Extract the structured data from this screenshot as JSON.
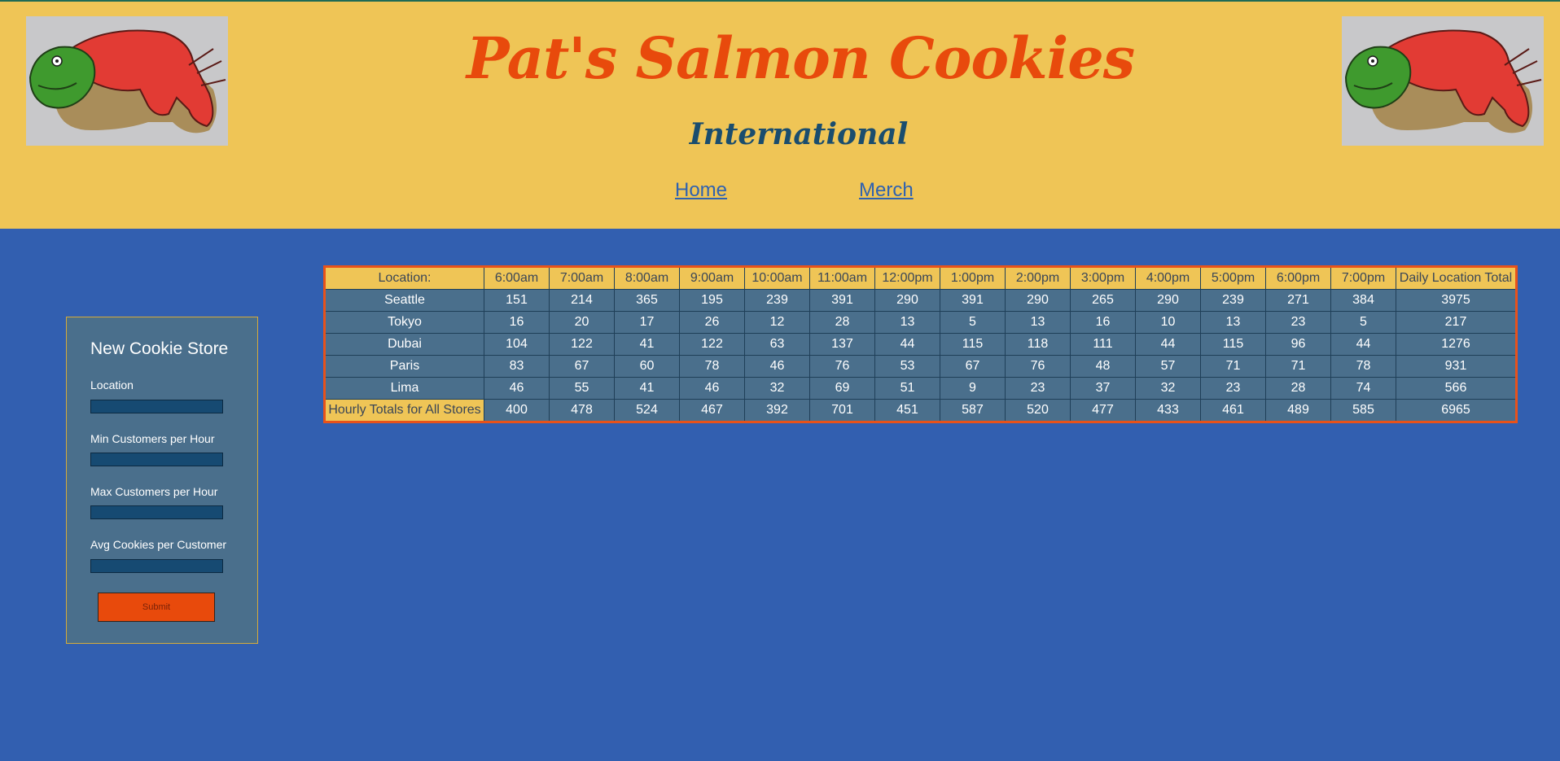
{
  "header": {
    "title": "Pat's Salmon Cookies",
    "subtitle": "International",
    "nav": [
      {
        "label": "Home"
      },
      {
        "label": "Merch"
      }
    ]
  },
  "form": {
    "heading": "New Cookie Store",
    "fields": [
      {
        "label": "Location",
        "value": ""
      },
      {
        "label": "Min Customers per Hour",
        "value": ""
      },
      {
        "label": "Max Customers per Hour",
        "value": ""
      },
      {
        "label": "Avg Cookies per Customer",
        "value": ""
      }
    ],
    "submit_label": "Submit"
  },
  "table": {
    "headers": [
      "Location:",
      "6:00am",
      "7:00am",
      "8:00am",
      "9:00am",
      "10:00am",
      "11:00am",
      "12:00pm",
      "1:00pm",
      "2:00pm",
      "3:00pm",
      "4:00pm",
      "5:00pm",
      "6:00pm",
      "7:00pm",
      "Daily Location Total"
    ],
    "rows": [
      {
        "location": "Seattle",
        "cells": [
          "151",
          "214",
          "365",
          "195",
          "239",
          "391",
          "290",
          "391",
          "290",
          "265",
          "290",
          "239",
          "271",
          "384",
          "3975"
        ]
      },
      {
        "location": "Tokyo",
        "cells": [
          "16",
          "20",
          "17",
          "26",
          "12",
          "28",
          "13",
          "5",
          "13",
          "16",
          "10",
          "13",
          "23",
          "5",
          "217"
        ]
      },
      {
        "location": "Dubai",
        "cells": [
          "104",
          "122",
          "41",
          "122",
          "63",
          "137",
          "44",
          "115",
          "118",
          "111",
          "44",
          "115",
          "96",
          "44",
          "1276"
        ]
      },
      {
        "location": "Paris",
        "cells": [
          "83",
          "67",
          "60",
          "78",
          "46",
          "76",
          "53",
          "67",
          "76",
          "48",
          "57",
          "71",
          "71",
          "78",
          "931"
        ]
      },
      {
        "location": "Lima",
        "cells": [
          "46",
          "55",
          "41",
          "46",
          "32",
          "69",
          "51",
          "9",
          "23",
          "37",
          "32",
          "23",
          "28",
          "74",
          "566"
        ]
      }
    ],
    "footer": {
      "label": "Hourly Totals for All Stores",
      "cells": [
        "400",
        "478",
        "524",
        "467",
        "392",
        "701",
        "451",
        "587",
        "520",
        "477",
        "433",
        "461",
        "489",
        "585",
        "6965"
      ]
    }
  },
  "colors": {
    "page_background": "#325fb0",
    "header_background": "#efc556",
    "title_color": "#e84a0c",
    "subtitle_color": "#1a4d6e",
    "panel_background": "#4a6f8c",
    "submit_background": "#e84a0c",
    "table_border": "#e8521a"
  },
  "icons": [
    "salmon-cookie-image-left",
    "salmon-cookie-image-right"
  ]
}
